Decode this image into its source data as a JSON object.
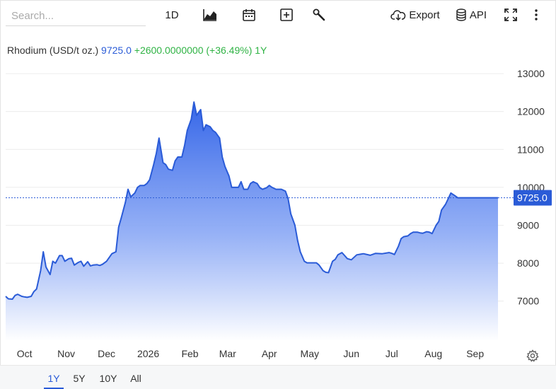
{
  "search": {
    "placeholder": "Search..."
  },
  "toolbar": {
    "interval_label": "1D",
    "export_label": "Export",
    "api_label": "API",
    "icons": [
      "area-chart-icon",
      "calendar-icon",
      "add-indicator-icon",
      "wrench-icon",
      "cloud-download-icon",
      "database-icon",
      "fullscreen-icon",
      "more-vert-icon"
    ]
  },
  "legend": {
    "name": "Rhodium (USD/t oz.)",
    "price": "9725.0",
    "change": "+2600.0000000 (+36.49%)",
    "period": "1Y"
  },
  "price_tag": "9725.0",
  "ranges": {
    "items": [
      "1Y",
      "5Y",
      "10Y",
      "All"
    ],
    "active": "1Y"
  },
  "colors": {
    "line": "#2a5bd7",
    "fill_top": "#3566e8",
    "tag": "#2a5bd7",
    "positive": "#2fb344"
  },
  "chart_data": {
    "type": "area",
    "title": "Rhodium (USD/t oz.)",
    "xlabel": "",
    "ylabel": "",
    "x_tick_labels": [
      "Oct",
      "Nov",
      "Dec",
      "2026",
      "Feb",
      "Mar",
      "Apr",
      "May",
      "Jun",
      "Jul",
      "Aug",
      "Sep"
    ],
    "y_ticks": [
      7000,
      8000,
      9000,
      10000,
      11000,
      12000,
      13000
    ],
    "ylim": [
      5950,
      13300
    ],
    "grid": true,
    "last_value": 9725.0,
    "x": [
      "2025-09-17",
      "2025-09-19",
      "2025-09-22",
      "2025-09-24",
      "2025-09-26",
      "2025-09-29",
      "2025-10-01",
      "2025-10-03",
      "2025-10-06",
      "2025-10-08",
      "2025-10-10",
      "2025-10-13",
      "2025-10-15",
      "2025-10-17",
      "2025-10-20",
      "2025-10-22",
      "2025-10-24",
      "2025-10-27",
      "2025-10-29",
      "2025-10-31",
      "2025-11-03",
      "2025-11-05",
      "2025-11-07",
      "2025-11-10",
      "2025-11-12",
      "2025-11-14",
      "2025-11-17",
      "2025-11-19",
      "2025-11-21",
      "2025-11-24",
      "2025-11-26",
      "2025-11-28",
      "2025-12-01",
      "2025-12-03",
      "2025-12-05",
      "2025-12-08",
      "2025-12-10",
      "2025-12-12",
      "2025-12-15",
      "2025-12-17",
      "2025-12-19",
      "2025-12-22",
      "2025-12-24",
      "2025-12-26",
      "2025-12-29",
      "2025-12-31",
      "2026-01-02",
      "2026-01-05",
      "2026-01-07",
      "2026-01-09",
      "2026-01-12",
      "2026-01-14",
      "2026-01-16",
      "2026-01-19",
      "2026-01-21",
      "2026-01-23",
      "2026-01-26",
      "2026-01-28",
      "2026-01-30",
      "2026-02-02",
      "2026-02-04",
      "2026-02-06",
      "2026-02-09",
      "2026-02-11",
      "2026-02-13",
      "2026-02-16",
      "2026-02-18",
      "2026-02-20",
      "2026-02-23",
      "2026-02-25",
      "2026-02-27",
      "2026-03-02",
      "2026-03-04",
      "2026-03-06",
      "2026-03-09",
      "2026-03-11",
      "2026-03-13",
      "2026-03-16",
      "2026-03-18",
      "2026-03-20",
      "2026-03-23",
      "2026-03-25",
      "2026-03-27",
      "2026-03-30",
      "2026-04-01",
      "2026-04-03",
      "2026-04-06",
      "2026-04-08",
      "2026-04-10",
      "2026-04-13",
      "2026-04-15",
      "2026-04-17",
      "2026-04-20",
      "2026-04-22",
      "2026-04-24",
      "2026-04-27",
      "2026-04-29",
      "2026-05-01",
      "2026-05-04",
      "2026-05-06",
      "2026-05-08",
      "2026-05-11",
      "2026-05-13",
      "2026-05-15",
      "2026-05-18",
      "2026-05-20",
      "2026-05-22",
      "2026-05-25",
      "2026-05-27",
      "2026-05-29",
      "2026-06-01",
      "2026-06-05",
      "2026-06-10",
      "2026-06-15",
      "2026-06-19",
      "2026-06-24",
      "2026-06-29",
      "2026-07-01",
      "2026-07-03",
      "2026-07-06",
      "2026-07-08",
      "2026-07-10",
      "2026-07-13",
      "2026-07-15",
      "2026-07-17",
      "2026-07-20",
      "2026-07-22",
      "2026-07-24",
      "2026-07-27",
      "2026-07-29",
      "2026-07-31",
      "2026-08-03",
      "2026-08-05",
      "2026-08-07",
      "2026-08-10",
      "2026-08-12",
      "2026-08-14",
      "2026-08-17",
      "2026-08-19",
      "2026-08-21",
      "2026-08-24",
      "2026-08-26",
      "2026-08-28",
      "2026-08-31",
      "2026-09-02",
      "2026-09-04",
      "2026-09-07",
      "2026-09-09",
      "2026-09-11",
      "2026-09-14",
      "2026-09-16",
      "2026-09-18"
    ],
    "series": [
      {
        "values": [
          7125,
          7060,
          7050,
          7150,
          7180,
          7125,
          7110,
          7100,
          7125,
          7250,
          7320,
          7800,
          8300,
          7900,
          7700,
          8050,
          8000,
          8200,
          8200,
          8050,
          8120,
          8130,
          7950,
          8020,
          8050,
          7920,
          8040,
          7930,
          7950,
          7960,
          7940,
          7970,
          8050,
          8150,
          8250,
          8300,
          8950,
          9200,
          9600,
          9950,
          9750,
          9850,
          10000,
          10050,
          10050,
          10100,
          10200,
          10600,
          10900,
          11300,
          10650,
          10600,
          10480,
          10450,
          10700,
          10800,
          10800,
          11100,
          11500,
          11800,
          12250,
          11900,
          12050,
          11500,
          11650,
          11600,
          11500,
          11450,
          11300,
          10800,
          10550,
          10300,
          10000,
          10000,
          10000,
          10150,
          9950,
          9950,
          10100,
          10150,
          10100,
          9990,
          9950,
          9990,
          10050,
          10000,
          9950,
          9950,
          9950,
          9900,
          9700,
          9300,
          9000,
          8600,
          8300,
          8050,
          8010,
          8010,
          8010,
          8010,
          7950,
          7800,
          7760,
          7750,
          8050,
          8100,
          8220,
          8280,
          8200,
          8120,
          8090,
          8220,
          8250,
          8210,
          8260,
          8250,
          8280,
          8260,
          8230,
          8450,
          8650,
          8700,
          8720,
          8780,
          8820,
          8820,
          8800,
          8790,
          8830,
          8820,
          8780,
          9000,
          9100,
          9400,
          9550,
          9700,
          9850,
          9780,
          9725,
          9725,
          9725,
          9725,
          9725,
          9725,
          9725,
          9725,
          9725,
          9725,
          9725,
          9725,
          9725,
          9725,
          9725,
          9725
        ]
      }
    ]
  }
}
